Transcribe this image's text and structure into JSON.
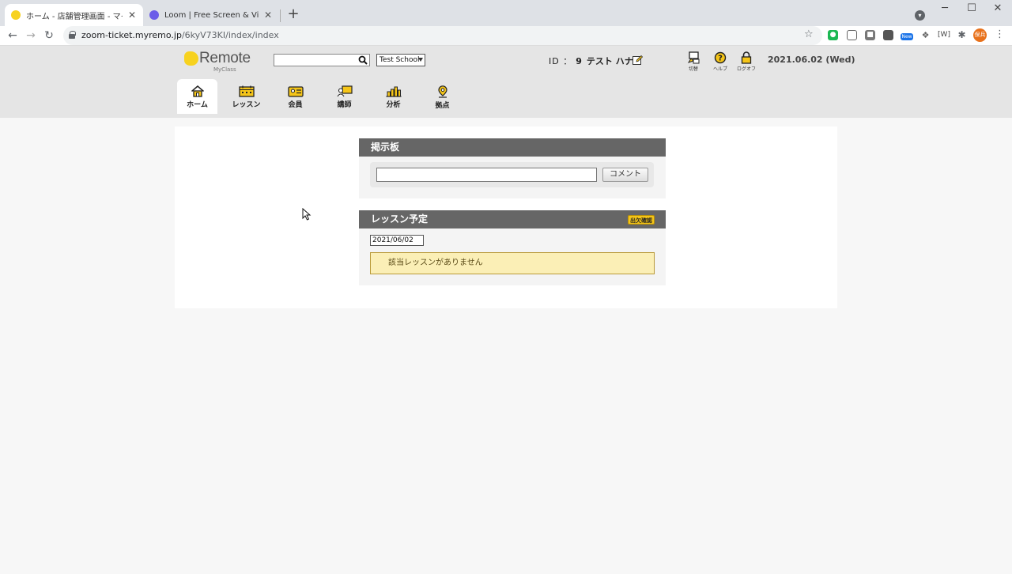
{
  "browser": {
    "tabs": [
      {
        "title": "ホーム - 店舗管理画面 - マイクラスR",
        "favicon_color": "#f7d21f",
        "active": true
      },
      {
        "title": "Loom | Free Screen & Video Rec",
        "favicon_color": "#6b5de8",
        "active": false
      }
    ],
    "new_tab_label": "+",
    "url_host": "zoom-ticket.myremo.jp",
    "url_path": "/6kyV73KI/index/index",
    "extensions": [
      {
        "icon": "evernote-icon",
        "color": "#1cb853"
      },
      {
        "icon": "pocket-icon",
        "color": "#777777"
      },
      {
        "icon": "camera-icon",
        "color": "#777777"
      },
      {
        "icon": "image-icon",
        "color": "#777777"
      },
      {
        "icon": "new-badge-icon",
        "color": "#1a73e8",
        "label": "New"
      },
      {
        "icon": "dropbox-icon",
        "color": "#777777"
      },
      {
        "icon": "bracket-icon",
        "color": "#444444",
        "label": "[W]"
      },
      {
        "icon": "puzzle-icon",
        "color": "#5f6368"
      }
    ],
    "avatar_text": "保兵"
  },
  "header": {
    "logo_word": "Remote",
    "logo_sub": "MyClass",
    "search": {
      "value": "",
      "placeholder": ""
    },
    "school_select": "Test School",
    "user": {
      "id_label": "ID ：",
      "id_value": "9",
      "name": "テスト ハナコ"
    },
    "utils": [
      {
        "name": "switch",
        "label": "切替"
      },
      {
        "name": "help",
        "label": "ヘルプ"
      },
      {
        "name": "logout",
        "label": "ログオフ"
      }
    ],
    "date": "2021.06.02 (Wed)"
  },
  "nav": [
    {
      "key": "home",
      "label": "ホーム",
      "icon": "home-icon",
      "active": true
    },
    {
      "key": "lesson",
      "label": "レッスン",
      "icon": "calendar-icon",
      "active": false
    },
    {
      "key": "member",
      "label": "会員",
      "icon": "id-card-icon",
      "active": false
    },
    {
      "key": "teacher",
      "label": "講師",
      "icon": "teacher-icon",
      "active": false
    },
    {
      "key": "analysis",
      "label": "分析",
      "icon": "bar-chart-icon",
      "active": false
    },
    {
      "key": "base",
      "label": "拠点",
      "icon": "location-pin-icon",
      "active": false
    }
  ],
  "board": {
    "title": "掲示板",
    "input_value": "",
    "comment_label": "コメント"
  },
  "lessons": {
    "title": "レッスン予定",
    "attendance_label": "出欠確認",
    "date_value": "2021/06/02",
    "empty_message": "該当レッスンがありません"
  },
  "colors": {
    "accent_yellow": "#f5c518",
    "section_header": "#666666",
    "notice_bg": "#fbefb6"
  }
}
